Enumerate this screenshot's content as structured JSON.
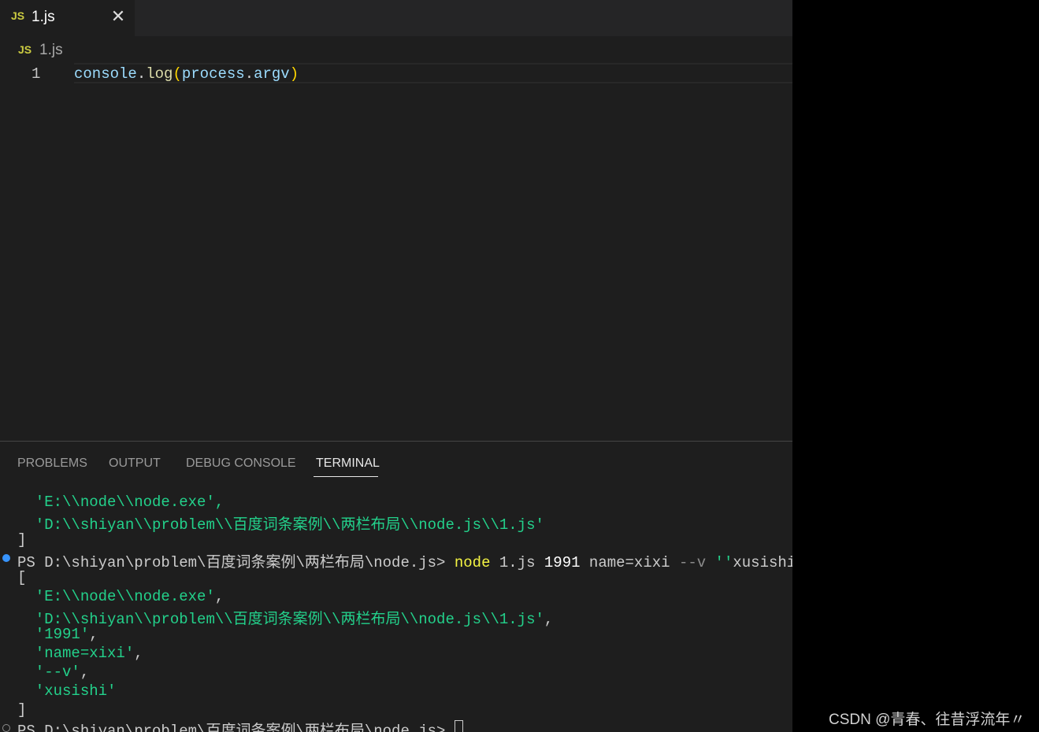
{
  "editor": {
    "tab": {
      "icon": "JS",
      "title": "1.js",
      "close": "✕"
    },
    "breadcrumb": {
      "icon": "JS",
      "label": "1.js"
    },
    "line_number": "1",
    "code": {
      "object": "console",
      "dot1": ".",
      "method": "log",
      "open": "(",
      "arg_object": "process",
      "dot2": ".",
      "arg_prop": "argv",
      "close": ")"
    }
  },
  "panel": {
    "tabs": [
      {
        "label": "PROBLEMS"
      },
      {
        "label": "OUTPUT"
      },
      {
        "label": "DEBUG CONSOLE"
      },
      {
        "label": "TERMINAL"
      }
    ],
    "terminal": {
      "prev_line1": "  'E:\\\\node\\\\node.exe',",
      "prev_line2": "  'D:\\\\shiyan\\\\problem\\\\百度词条案例\\\\两栏布局\\\\node.js\\\\1.js'",
      "close1": "]",
      "prompt": "PS D:\\shiyan\\problem\\百度词条案例\\两栏布局\\node.js> ",
      "cmd": "node",
      "cmd_file": " 1.js ",
      "cmd_num": "1991",
      "cmd_arg": " name=xixi ",
      "cmd_flag": "--v",
      "cmd_quote": " ''",
      "cmd_rest": "xusishi",
      "open": "[",
      "out_line1": "  'E:\\\\node\\\\node.exe'",
      "out_line2": "  'D:\\\\shiyan\\\\problem\\\\百度词条案例\\\\两栏布局\\\\node.js\\\\1.js'",
      "out_line3": "  '1991'",
      "out_line4": "  'name=xixi'",
      "out_line5": "  '--v'",
      "out_line6": "  'xusishi'",
      "comma": ",",
      "close2": "]",
      "prompt2": "PS D:\\shiyan\\problem\\百度词条案例\\两栏布局\\node.js> "
    }
  },
  "watermark": "CSDN @青春、往昔浮流年〃"
}
